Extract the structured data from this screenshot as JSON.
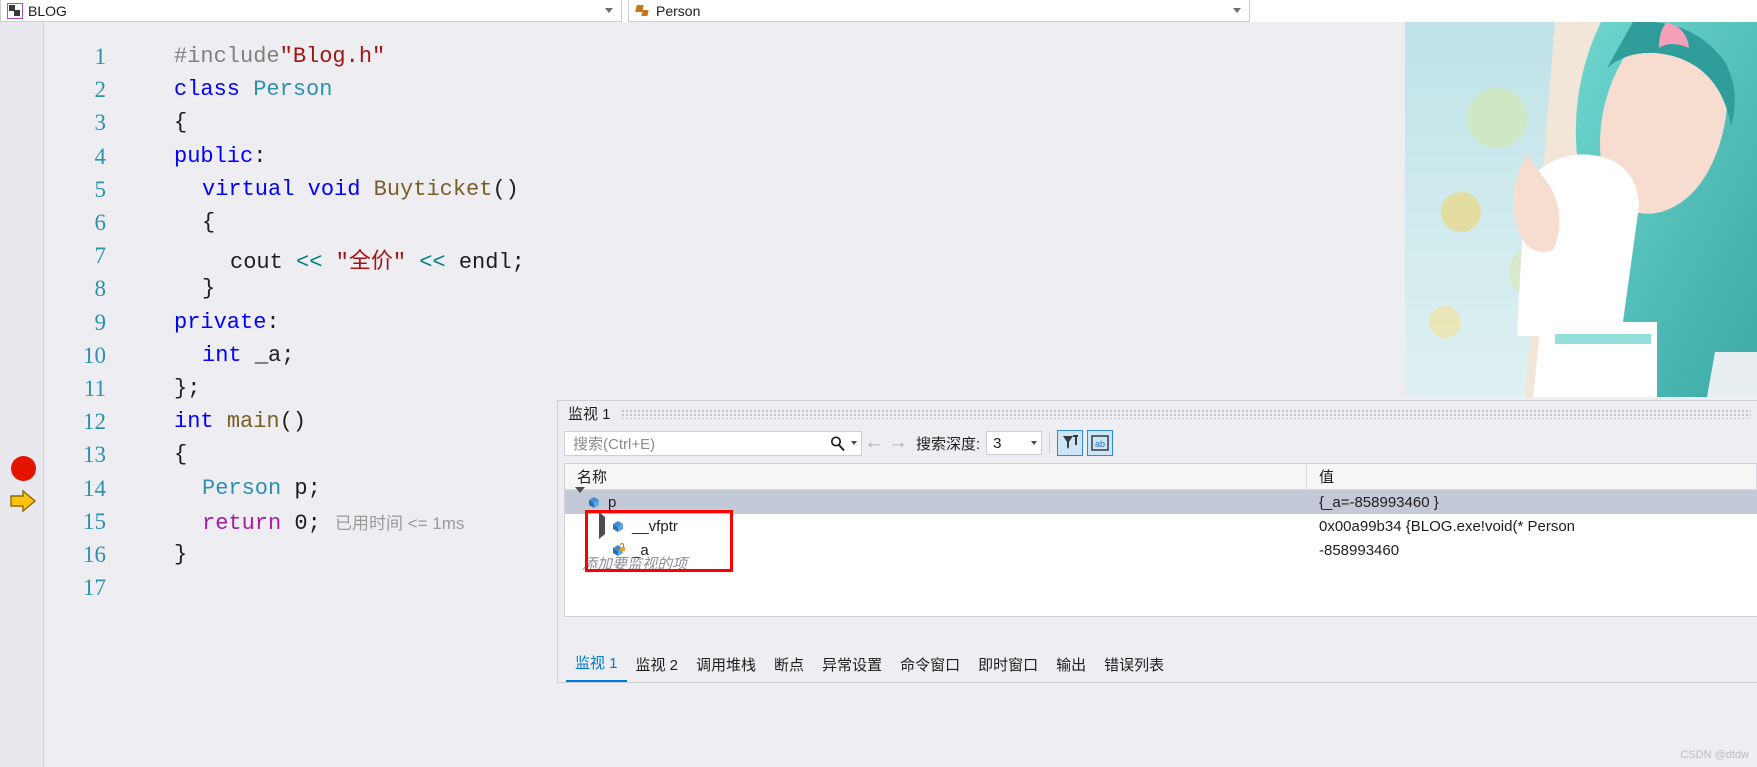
{
  "navbar": {
    "project_combo": {
      "label": "BLOG",
      "icon": "class-selector-icon"
    },
    "member_combo": {
      "label": "Person",
      "icon": "class-member-icon"
    }
  },
  "editor": {
    "breakpoint_line": 14,
    "current_line": 15,
    "elapsed_annotation": "已用时间 <= 1ms",
    "lines": [
      {
        "n": "1",
        "indent": 0,
        "tokens": [
          {
            "t": "#include",
            "c": "c-pre"
          },
          {
            "t": "\"Blog.h\"",
            "c": "c-str"
          }
        ]
      },
      {
        "n": "2",
        "indent": 0,
        "tokens": [
          {
            "t": "class ",
            "c": "c-kw"
          },
          {
            "t": "Person",
            "c": "c-type"
          }
        ]
      },
      {
        "n": "3",
        "indent": 0,
        "tokens": [
          {
            "t": "{",
            "c": "c-pun"
          }
        ]
      },
      {
        "n": "4",
        "indent": 0,
        "tokens": [
          {
            "t": "public",
            "c": "c-kw"
          },
          {
            "t": ":",
            "c": "c-pun"
          }
        ]
      },
      {
        "n": "5",
        "indent": 1,
        "tokens": [
          {
            "t": "virtual void ",
            "c": "c-kw"
          },
          {
            "t": "Buyticket",
            "c": "c-fn"
          },
          {
            "t": "()",
            "c": "c-pun"
          }
        ]
      },
      {
        "n": "6",
        "indent": 1,
        "tokens": [
          {
            "t": "{",
            "c": "c-pun"
          }
        ]
      },
      {
        "n": "7",
        "indent": 2,
        "tokens": [
          {
            "t": "cout ",
            "c": "c-plain"
          },
          {
            "t": "<< ",
            "c": "c-op"
          },
          {
            "t": "\"全价\"",
            "c": "c-str"
          },
          {
            "t": " << ",
            "c": "c-op"
          },
          {
            "t": "endl",
            "c": "c-plain"
          },
          {
            "t": ";",
            "c": "c-pun"
          }
        ]
      },
      {
        "n": "8",
        "indent": 1,
        "tokens": [
          {
            "t": "}",
            "c": "c-pun"
          }
        ]
      },
      {
        "n": "9",
        "indent": 0,
        "tokens": [
          {
            "t": "private",
            "c": "c-kw"
          },
          {
            "t": ":",
            "c": "c-pun"
          }
        ]
      },
      {
        "n": "10",
        "indent": 1,
        "tokens": [
          {
            "t": "int ",
            "c": "c-kw"
          },
          {
            "t": "_a",
            "c": "c-plain"
          },
          {
            "t": ";",
            "c": "c-pun"
          }
        ]
      },
      {
        "n": "11",
        "indent": 0,
        "tokens": [
          {
            "t": "};",
            "c": "c-pun"
          }
        ]
      },
      {
        "n": "12",
        "indent": 0,
        "tokens": [
          {
            "t": "int ",
            "c": "c-kw"
          },
          {
            "t": "main",
            "c": "c-fn"
          },
          {
            "t": "()",
            "c": "c-pun"
          }
        ]
      },
      {
        "n": "13",
        "indent": 0,
        "tokens": [
          {
            "t": "{",
            "c": "c-pun"
          }
        ]
      },
      {
        "n": "14",
        "indent": 1,
        "tokens": [
          {
            "t": "Person",
            "c": "c-type"
          },
          {
            "t": " p;",
            "c": "c-plain"
          }
        ]
      },
      {
        "n": "15",
        "indent": 1,
        "tokens": [
          {
            "t": "return ",
            "c": "c-purp"
          },
          {
            "t": "0",
            "c": "c-plain"
          },
          {
            "t": ";",
            "c": "c-pun"
          }
        ]
      },
      {
        "n": "16",
        "indent": 0,
        "tokens": [
          {
            "t": "}",
            "c": "c-pun"
          }
        ]
      },
      {
        "n": "17",
        "indent": 0,
        "tokens": []
      }
    ]
  },
  "watch": {
    "title": "监视 1",
    "search": {
      "placeholder": "搜索(Ctrl+E)",
      "value": "",
      "icon": "search-icon"
    },
    "nav_back_icon": "arrow-left-icon",
    "nav_forward_icon": "arrow-right-icon",
    "depth_label": "搜索深度:",
    "depth_value": "3",
    "toolbar_buttons": [
      {
        "name": "filter-pin-button",
        "icon": "pin-filter-icon"
      },
      {
        "name": "hex-display-button",
        "icon": "hex-display-icon"
      }
    ],
    "columns": {
      "name": "名称",
      "value": "值"
    },
    "rows": [
      {
        "name": "p",
        "value": "{_a=-858993460 }",
        "depth": 0,
        "expander": "down",
        "icon": "object-cube-icon",
        "selected": true
      },
      {
        "name": "__vfptr",
        "value": "0x00a99b34 {BLOG.exe!void(* Person",
        "depth": 1,
        "expander": "right",
        "icon": "object-cube-icon",
        "selected": false
      },
      {
        "name": "_a",
        "value": "-858993460",
        "depth": 1,
        "expander": "none",
        "icon": "field-lock-icon",
        "selected": false
      }
    ],
    "add_watch_placeholder": "添加要监视的项"
  },
  "bottom_tabs": [
    {
      "label": "监视 1",
      "active": true
    },
    {
      "label": "监视 2",
      "active": false
    },
    {
      "label": "调用堆栈",
      "active": false
    },
    {
      "label": "断点",
      "active": false
    },
    {
      "label": "异常设置",
      "active": false
    },
    {
      "label": "命令窗口",
      "active": false
    },
    {
      "label": "即时窗口",
      "active": false
    },
    {
      "label": "输出",
      "active": false
    },
    {
      "label": "错误列表",
      "active": false
    }
  ],
  "watermark": "CSDN @dtdw",
  "colors": {
    "breakpoint_red": "#e51400",
    "current_arrow_yellow": "#ffc20e",
    "change_bar_green": "#73d273",
    "annotation_red": "#ff0000",
    "accent_blue": "#0078d4"
  }
}
